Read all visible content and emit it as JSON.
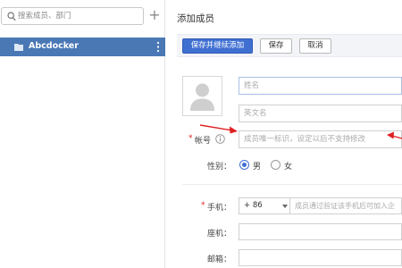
{
  "sidebar": {
    "search_placeholder": "搜索成员、部门",
    "add_symbol": "+",
    "department": {
      "name": "Abcdocker"
    }
  },
  "main": {
    "title": "添加成员",
    "toolbar": {
      "save_and_continue": "保存并继续添加",
      "save": "保存",
      "cancel": "取消"
    },
    "form": {
      "name_placeholder": "姓名",
      "english_name_placeholder": "英文名",
      "account": {
        "required_mark": "*",
        "label": "帐号",
        "placeholder": "成员唯一标识，设定以后不支持修改"
      },
      "gender": {
        "label": "性别：",
        "options": [
          "男",
          "女"
        ],
        "selected": "男"
      },
      "mobile": {
        "required_mark": "*",
        "label": "手机：",
        "country_code": "+ 86",
        "placeholder": "成员通过验证该手机后可加入企"
      },
      "phone": {
        "label": "座机："
      },
      "email": {
        "label": "邮箱："
      }
    }
  },
  "colors": {
    "primary": "#3f6fd1",
    "sidebar_selected": "#4a78b5",
    "required": "#e02020",
    "annotation_arrow": "#e02020"
  }
}
